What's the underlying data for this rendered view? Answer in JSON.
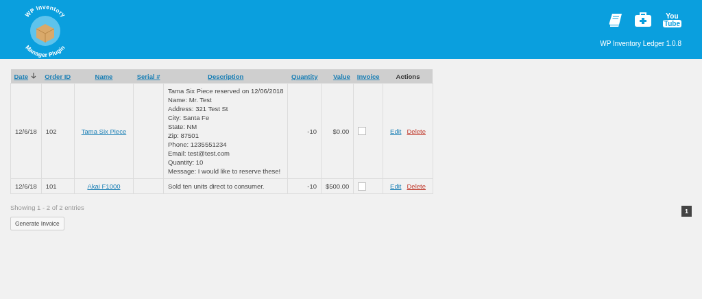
{
  "header": {
    "logo_text_top": "WP Inventory",
    "logo_text_bottom": "Manager Plugin",
    "youtube_label": [
      "You",
      "Tube"
    ],
    "version": "WP Inventory Ledger 1.0.8"
  },
  "table": {
    "columns": [
      {
        "label": "Date",
        "sortable": true,
        "sorted": true
      },
      {
        "label": "Order ID",
        "sortable": true,
        "sorted": false
      },
      {
        "label": "Name",
        "sortable": true,
        "sorted": false
      },
      {
        "label": "Serial #",
        "sortable": true,
        "sorted": false
      },
      {
        "label": "Description",
        "sortable": true,
        "sorted": false
      },
      {
        "label": "Quantity",
        "sortable": true,
        "sorted": false
      },
      {
        "label": "Value",
        "sortable": true,
        "sorted": false
      },
      {
        "label": "Invoice",
        "sortable": true,
        "sorted": false
      },
      {
        "label": "Actions",
        "sortable": false
      }
    ],
    "rows": [
      {
        "date": "12/6/18",
        "order_id": "102",
        "name": "Tama Six Piece",
        "description": [
          "Tama Six Piece reserved on 12/06/2018",
          "Name: Mr. Test",
          "Address: 321 Test St",
          "City: Santa Fe",
          "State: NM",
          "Zip: 87501",
          "Phone: 1235551234",
          "Email: test@test.com",
          "Quantity: 10",
          "Message: I would like to reserve these!"
        ],
        "quantity": "-10",
        "value": "$0.00",
        "invoice": false,
        "actions": [
          "Edit",
          "Delete"
        ]
      },
      {
        "date": "12/6/18",
        "order_id": "101",
        "name": "Akai F1000",
        "description": [
          "Sold ten units direct to consumer."
        ],
        "quantity": "-10",
        "value": "$500.00",
        "invoice": false,
        "actions": [
          "Edit",
          "Delete"
        ]
      }
    ]
  },
  "footer": {
    "summary": "Showing 1 - 2 of 2 entries",
    "button": "Generate Invoice",
    "pages": [
      {
        "label": "1",
        "selected": true
      }
    ]
  }
}
